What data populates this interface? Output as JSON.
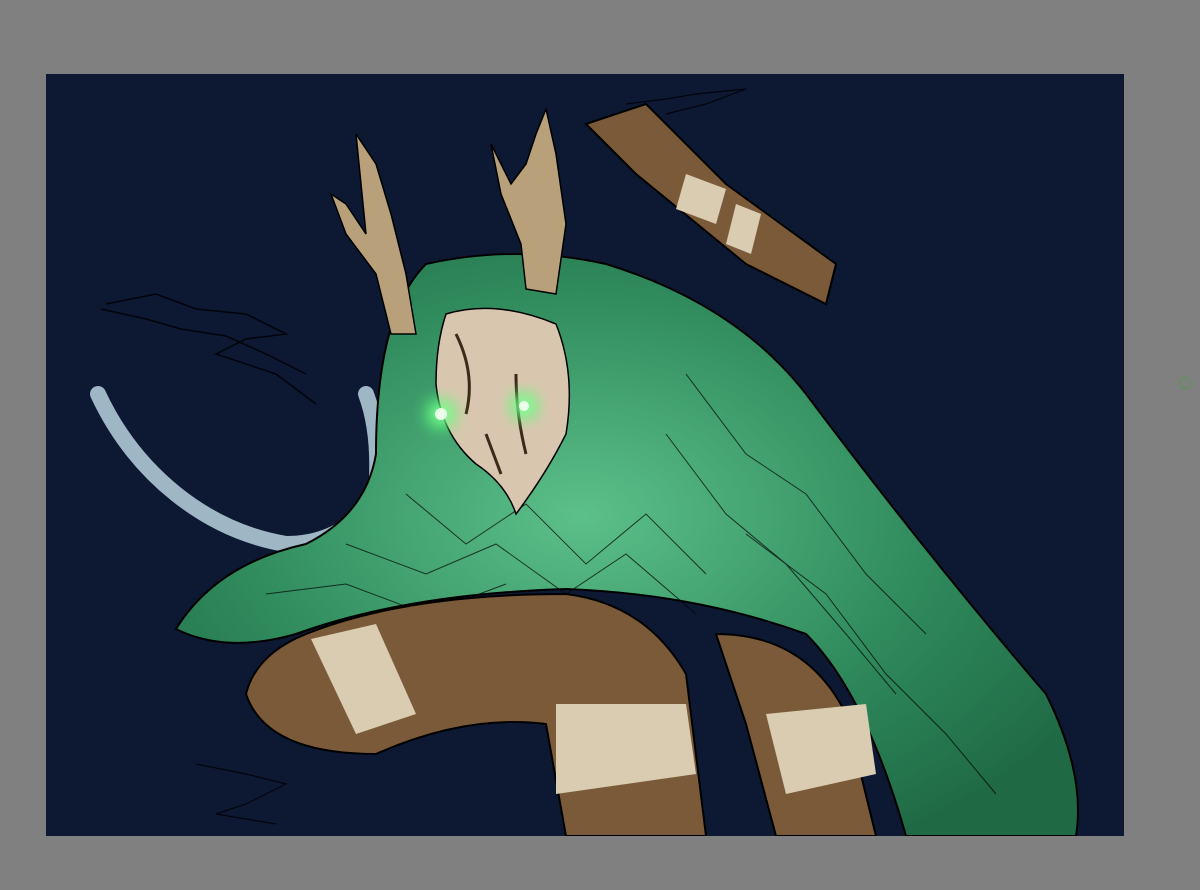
{
  "app": {
    "workspace_color": "#808080",
    "canvas_background": "#0d1833"
  },
  "artwork": {
    "subject_icon": "antlered-skull-creature-sketch",
    "palette": {
      "cloak": "#2f8a5c",
      "cloak_highlight": "#5cc08a",
      "skin": "#7b5a3a",
      "bandage": "#d9ccb0",
      "skull": "#d8c7ae",
      "eye_glow": "#5dff7a",
      "rope": "#9fb6c4",
      "line": "#0a0a0a"
    }
  },
  "cursor": {
    "icon": "brush-cursor-icon",
    "color": "#4f9a4f"
  }
}
